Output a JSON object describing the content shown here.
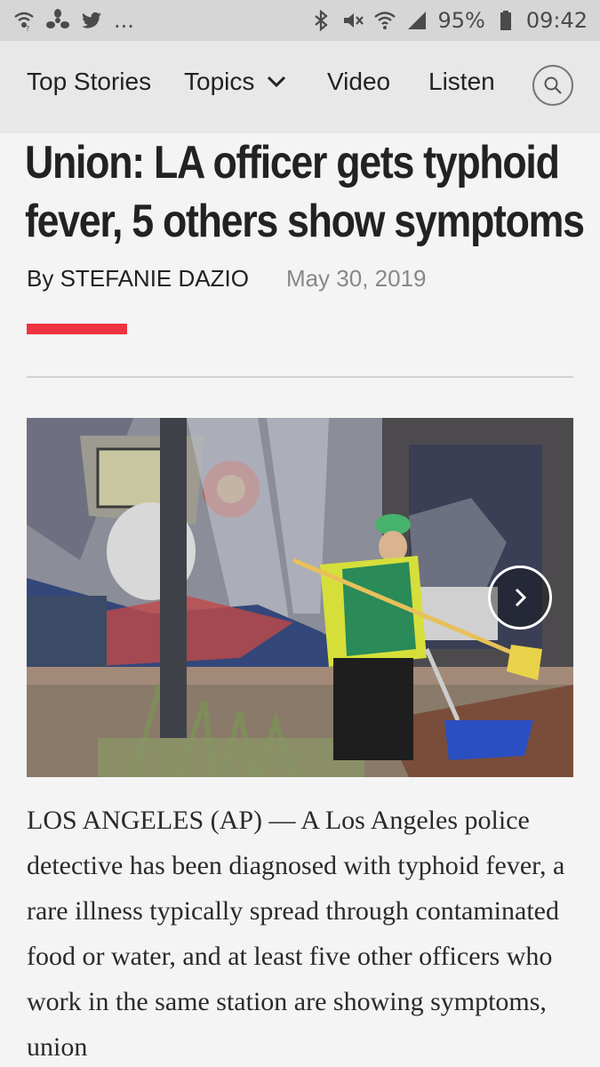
{
  "status_bar": {
    "ellipsis": "...",
    "battery": "95%",
    "time": "09:42"
  },
  "nav": {
    "top_stories": "Top Stories",
    "topics": "Topics",
    "video": "Video",
    "listen": "Listen"
  },
  "article": {
    "headline": "Union: LA officer gets typhoid fever, 5 others show symptoms",
    "author": "By STEFANIE DAZIO",
    "date": "May 30, 2019",
    "body": "LOS ANGELES (AP) — A Los Angeles police detective has been diagnosed with typhoid fever, a rare illness typically spread through contaminated food or water, and at least five other officers who work in the same station are showing symptoms, union"
  },
  "colors": {
    "accent_red": "#ef3340",
    "nav_bg": "#e8e8e8",
    "status_bg": "#d6d6d6"
  }
}
